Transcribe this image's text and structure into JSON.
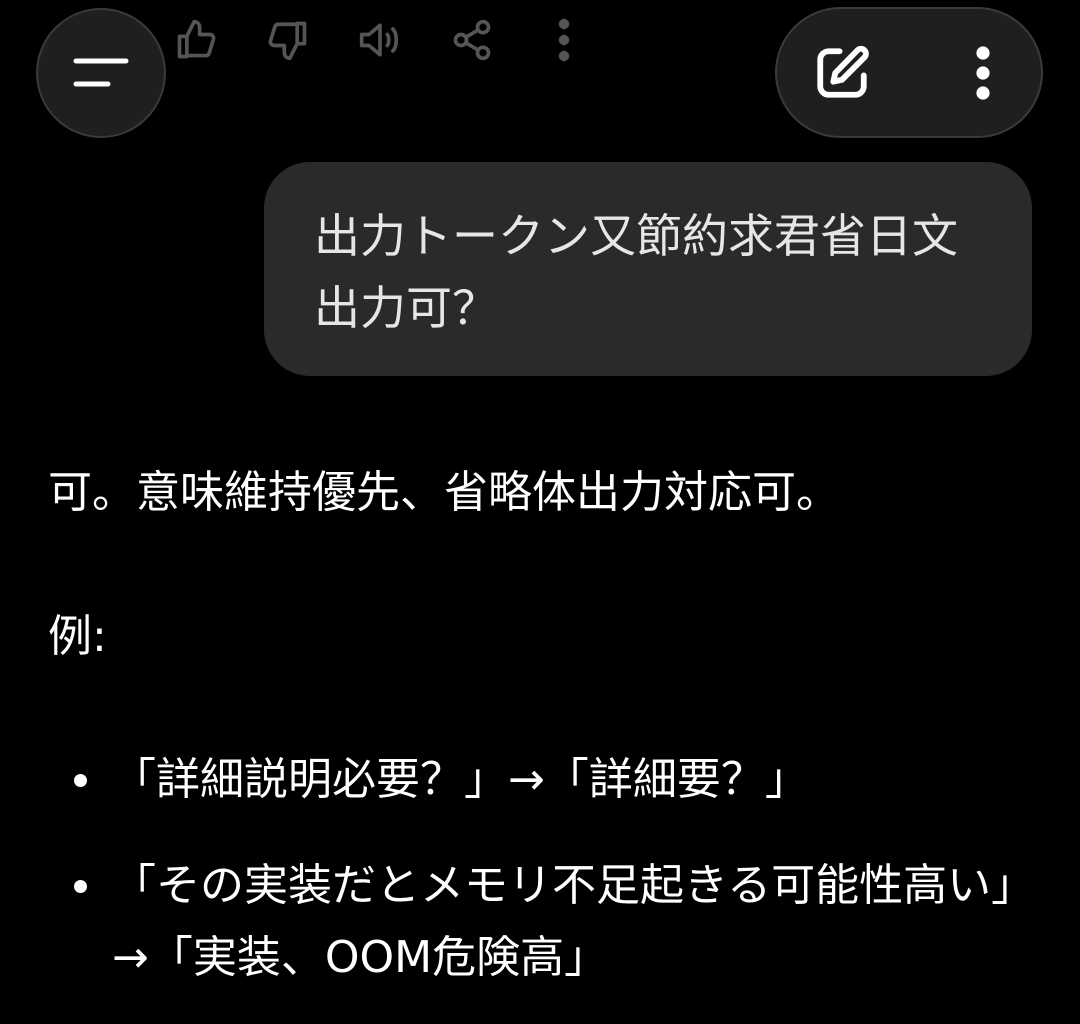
{
  "header": {
    "action_icons": [
      "thumb-up-icon",
      "thumb-down-icon",
      "speaker-icon",
      "share-icon",
      "more-vertical-icon"
    ],
    "menu_icon": "menu-icon",
    "new_chat_icon": "edit-icon",
    "overflow_icon": "more-vertical-icon"
  },
  "conversation": {
    "user_message": "出力トークン又節約求君省日文出力可？",
    "assistant": {
      "intro": "可。意味維持優先、省略体出力対応可。",
      "example_label": "例:",
      "examples": [
        "「詳細説明必要？」→「詳細要？」",
        "「その実装だとメモリ不足起きる可能性高い」→「実装、OOM危険高」"
      ]
    }
  },
  "colors": {
    "background": "#000000",
    "bubble": "#2a2a2a",
    "button": "#1f1f1f",
    "text": "#ffffff"
  }
}
